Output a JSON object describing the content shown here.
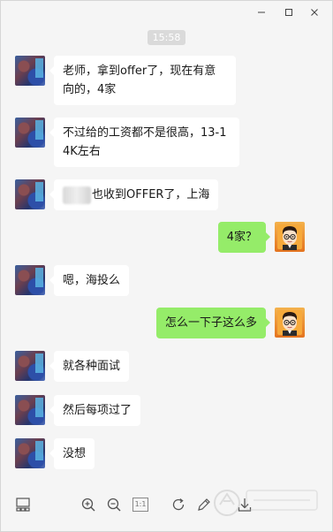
{
  "window": {
    "controls": [
      "minimize",
      "maximize",
      "close"
    ]
  },
  "time_divider": "15:58",
  "messages": [
    {
      "side": "left",
      "avatar": "friend-avatar",
      "text": "老师，拿到offer了，现在有意向的，4家"
    },
    {
      "side": "left",
      "avatar": "friend-avatar",
      "text": "不过给的工资都不是很高，13-14K左右"
    },
    {
      "side": "left",
      "avatar": "friend-avatar",
      "text": "也收到OFFER了，上海",
      "redacted_prefix": true
    },
    {
      "side": "right",
      "avatar": "my-avatar",
      "text": "4家？"
    },
    {
      "side": "left",
      "avatar": "friend-avatar",
      "text": "嗯，海投么"
    },
    {
      "side": "right",
      "avatar": "my-avatar",
      "text": "怎么一下子这么多"
    },
    {
      "side": "left",
      "avatar": "friend-avatar",
      "text": "就各种面试"
    },
    {
      "side": "left",
      "avatar": "friend-avatar",
      "text": "然后每项过了"
    },
    {
      "side": "left",
      "avatar": "friend-avatar",
      "text": "没想"
    }
  ],
  "toolbar": {
    "icons": [
      "layout-icon",
      "zoom-in-icon",
      "zoom-out-icon",
      "actual-size-icon",
      "rotate-icon",
      "edit-icon",
      "download-icon"
    ],
    "actual_size_label": "1:1"
  },
  "colors": {
    "background": "#f5f5f5",
    "incoming_bubble": "#ffffff",
    "outgoing_bubble": "#95ec69",
    "time_pill": "#dadada"
  }
}
